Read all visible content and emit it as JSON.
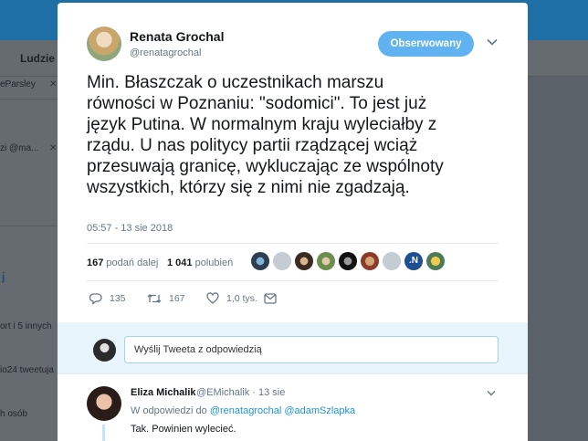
{
  "background": {
    "nav_label": "Ludzie",
    "left_items": [
      "eParsley",
      "zi @ma...",
      "j",
      "ort i 5 innych",
      "io24 tweetuja",
      "h osób"
    ]
  },
  "tweet": {
    "author_name": "Renata Grochal",
    "author_handle": "@renatagrochal",
    "follow_label": "Obserwowany",
    "text_lines": [
      "Min. Błaszczak o uczestnikach marszu",
      "równości w Poznaniu: \"sodomici\". To jest już",
      "język Putina. W normalnym kraju wyleciałby z",
      "rządu. U nas politycy partii rządzącej wciąż",
      "przesuwają granicę, wykluczając ze wspólnoty",
      "wszystkich, którzy się z nimi nie zgadzają."
    ],
    "timestamp": "05:57 - 13 sie 2018",
    "retweets_count": "167",
    "retweets_label": "podań dalej",
    "likes_count": "1 041",
    "likes_label": "polubień",
    "actions": {
      "replies": "135",
      "retweets": "167",
      "likes": "1,0 tys."
    }
  },
  "reply_box": {
    "placeholder": "Wyślij Tweeta z odpowiedzią"
  },
  "reply": {
    "name": "Eliza Michalik",
    "meta": "@EMichalik · 13 sie",
    "in_reply_prefix": "W odpowiedzi do",
    "mention1": "@renatagrochal",
    "mention2": "@adamSzlapka",
    "text": "Tak. Powinien wylecieć."
  },
  "colors": {
    "accent": "#1b95e0",
    "follow_button": "#60b3f0",
    "topbar": "#1d6fa5"
  }
}
